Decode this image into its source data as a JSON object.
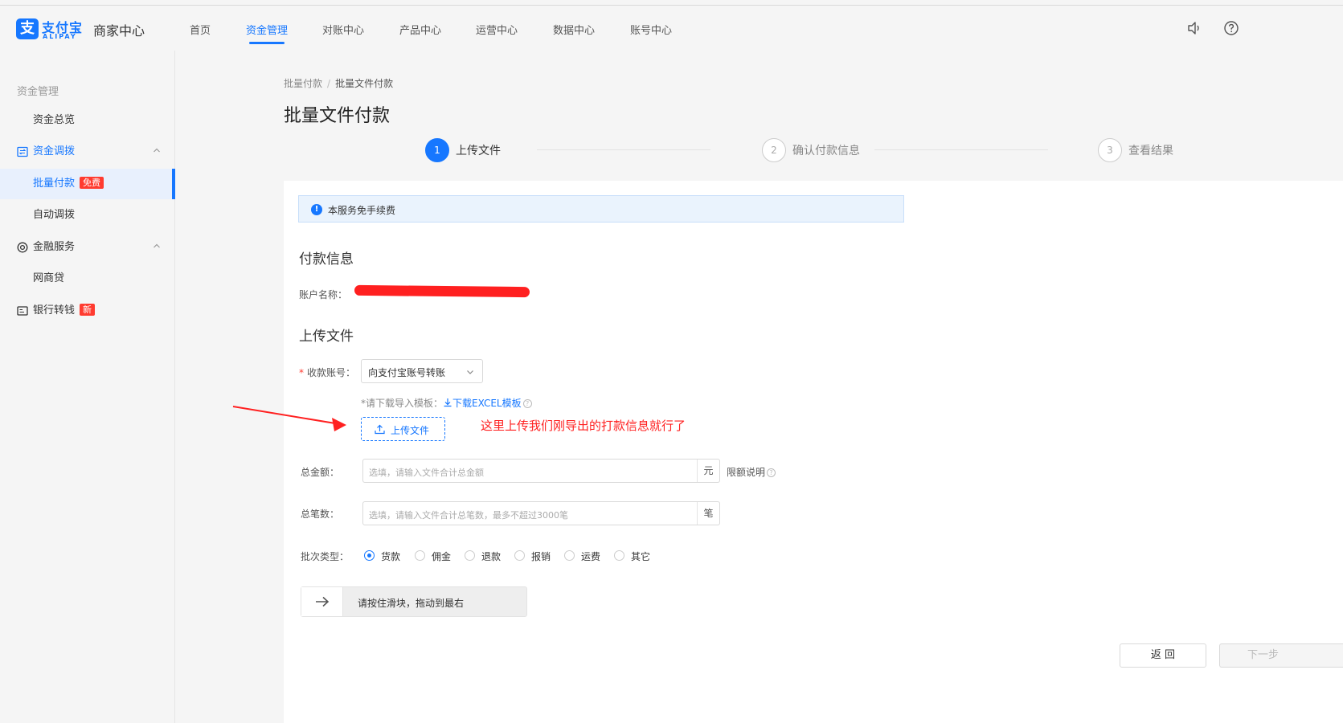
{
  "header": {
    "logo_mark": "支",
    "logo_text": "支付宝",
    "logo_sub": "ALIPAY",
    "app_title": "商家中心",
    "nav": [
      "首页",
      "资金管理",
      "对账中心",
      "产品中心",
      "运营中心",
      "数据中心",
      "账号中心"
    ],
    "active_nav": "资金管理",
    "icons": [
      "speaker-icon",
      "help-icon"
    ]
  },
  "sidebar": {
    "group_title": "资金管理",
    "items": [
      {
        "label": "资金总览"
      },
      {
        "label": "资金调拨",
        "icon": "transfer-icon"
      },
      {
        "label": "批量付款",
        "badge": "免费"
      },
      {
        "label": "自动调拨"
      },
      {
        "label": "金融服务",
        "icon": "target-icon"
      },
      {
        "label": "网商贷"
      },
      {
        "label": "银行转钱",
        "icon": "bank-card-icon",
        "badge": "新"
      }
    ]
  },
  "breadcrumb": {
    "parent": "批量付款",
    "sep": "/",
    "current": "批量文件付款"
  },
  "page_title": "批量文件付款",
  "steps": [
    {
      "num": "1",
      "label": "上传文件"
    },
    {
      "num": "2",
      "label": "确认付款信息"
    },
    {
      "num": "3",
      "label": "查看结果"
    }
  ],
  "notice": {
    "icon_char": "!",
    "text": "本服务免手续费"
  },
  "payment_info": {
    "title": "付款信息",
    "account_label": "账户名称："
  },
  "upload": {
    "title": "上传文件",
    "recv_label": "收款账号：",
    "recv_select": "向支付宝账号转账",
    "template_hint": "*请下载导入模板：",
    "template_link": "下载EXCEL模板",
    "upload_button": "上传文件",
    "annotation": "这里上传我们刚导出的打款信息就行了"
  },
  "amount": {
    "label": "总金额：",
    "placeholder": "选填，请输入文件合计总金额",
    "suffix": "元",
    "limit_label": "限额说明"
  },
  "count": {
    "label": "总笔数：",
    "placeholder": "选填，请输入文件合计总笔数，最多不超过3000笔",
    "suffix": "笔"
  },
  "batch_type": {
    "label": "批次类型：",
    "options": [
      "货款",
      "佣金",
      "退款",
      "报销",
      "运费",
      "其它"
    ],
    "selected": "货款"
  },
  "slider": {
    "text": "请按住滑块，拖动到最右"
  },
  "buttons": {
    "back": "返 回",
    "next": "下一步"
  },
  "colors": {
    "primary": "#1677ff",
    "danger": "#ff3b30",
    "annotation": "#ff2020"
  }
}
